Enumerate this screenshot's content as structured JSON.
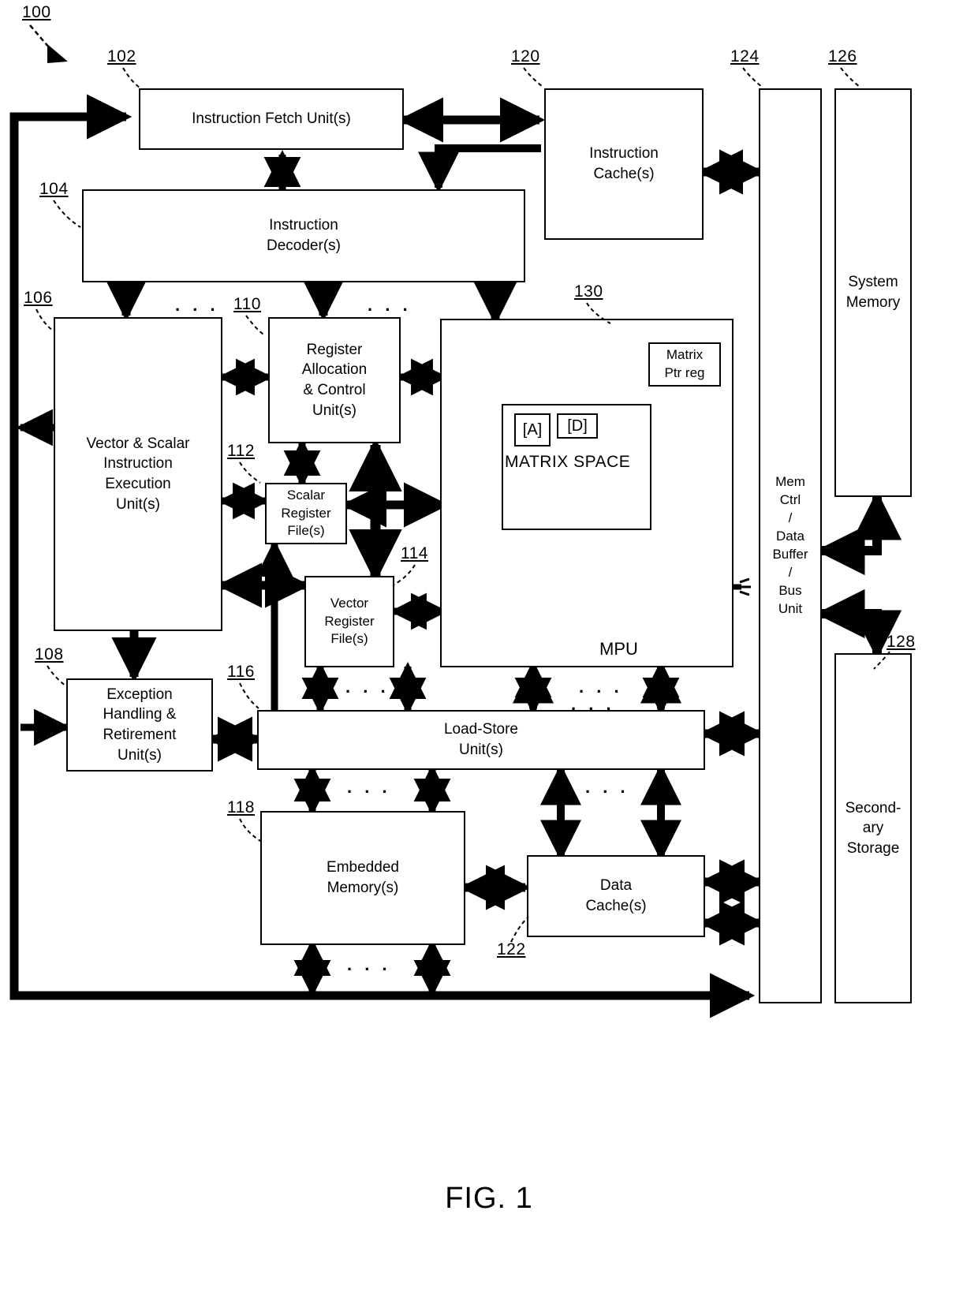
{
  "figure": {
    "caption": "FIG. 1",
    "root_ref": "100"
  },
  "blocks": [
    {
      "id": "ifu",
      "ref": "102",
      "label": "Instruction Fetch Unit(s)"
    },
    {
      "id": "idec",
      "ref": "104",
      "label": "Instruction\nDecoder(s)"
    },
    {
      "id": "vsieu",
      "ref": "106",
      "label": "Vector & Scalar\nInstruction\nExecution\nUnit(s)"
    },
    {
      "id": "ehru",
      "ref": "108",
      "label": "Exception\nHandling &\nRetirement\nUnit(s)"
    },
    {
      "id": "racu",
      "ref": "110",
      "label": "Register\nAllocation\n&  Control\nUnit(s)"
    },
    {
      "id": "srf",
      "ref": "112",
      "label": "Scalar\nRegister\nFile(s)"
    },
    {
      "id": "vrf",
      "ref": "114",
      "label": "Vector\nRegister\nFile(s)"
    },
    {
      "id": "lsu",
      "ref": "116",
      "label": "Load-Store\nUnit(s)"
    },
    {
      "id": "emem",
      "ref": "118",
      "label": "Embedded\nMemory(s)"
    },
    {
      "id": "icache",
      "ref": "120",
      "label": "Instruction\nCache(s)"
    },
    {
      "id": "dcache",
      "ref": "122",
      "label": "Data\nCache(s)"
    },
    {
      "id": "memctrl",
      "ref": "124",
      "label": "Mem\nCtrl\n/\nData\nBuffer\n/\nBus\nUnit"
    },
    {
      "id": "sysmem",
      "ref": "126",
      "label": "System\nMemory"
    },
    {
      "id": "secstor",
      "ref": "128",
      "label": "Second-\nary\nStorage"
    },
    {
      "id": "mpu",
      "ref": "130",
      "label": "MPU"
    }
  ],
  "mpu": {
    "ref": "130",
    "unit_label": "MPU",
    "matrix_space_label": "MATRIX SPACE",
    "matrix_a_label": "[A]",
    "matrix_d_label": "[D]",
    "ptr_reg_label": "Matrix\nPtr reg"
  },
  "ellipses": {
    "glyph": ". . .",
    "count_decoder_row": 2,
    "count_lsu_top": 2,
    "count_lsu_bottom": 2,
    "count_emem_bottom": 1,
    "count_mpu_row": 1
  },
  "colors": {
    "line": "#000000",
    "background": "#ffffff",
    "fill": "#ffffff"
  }
}
